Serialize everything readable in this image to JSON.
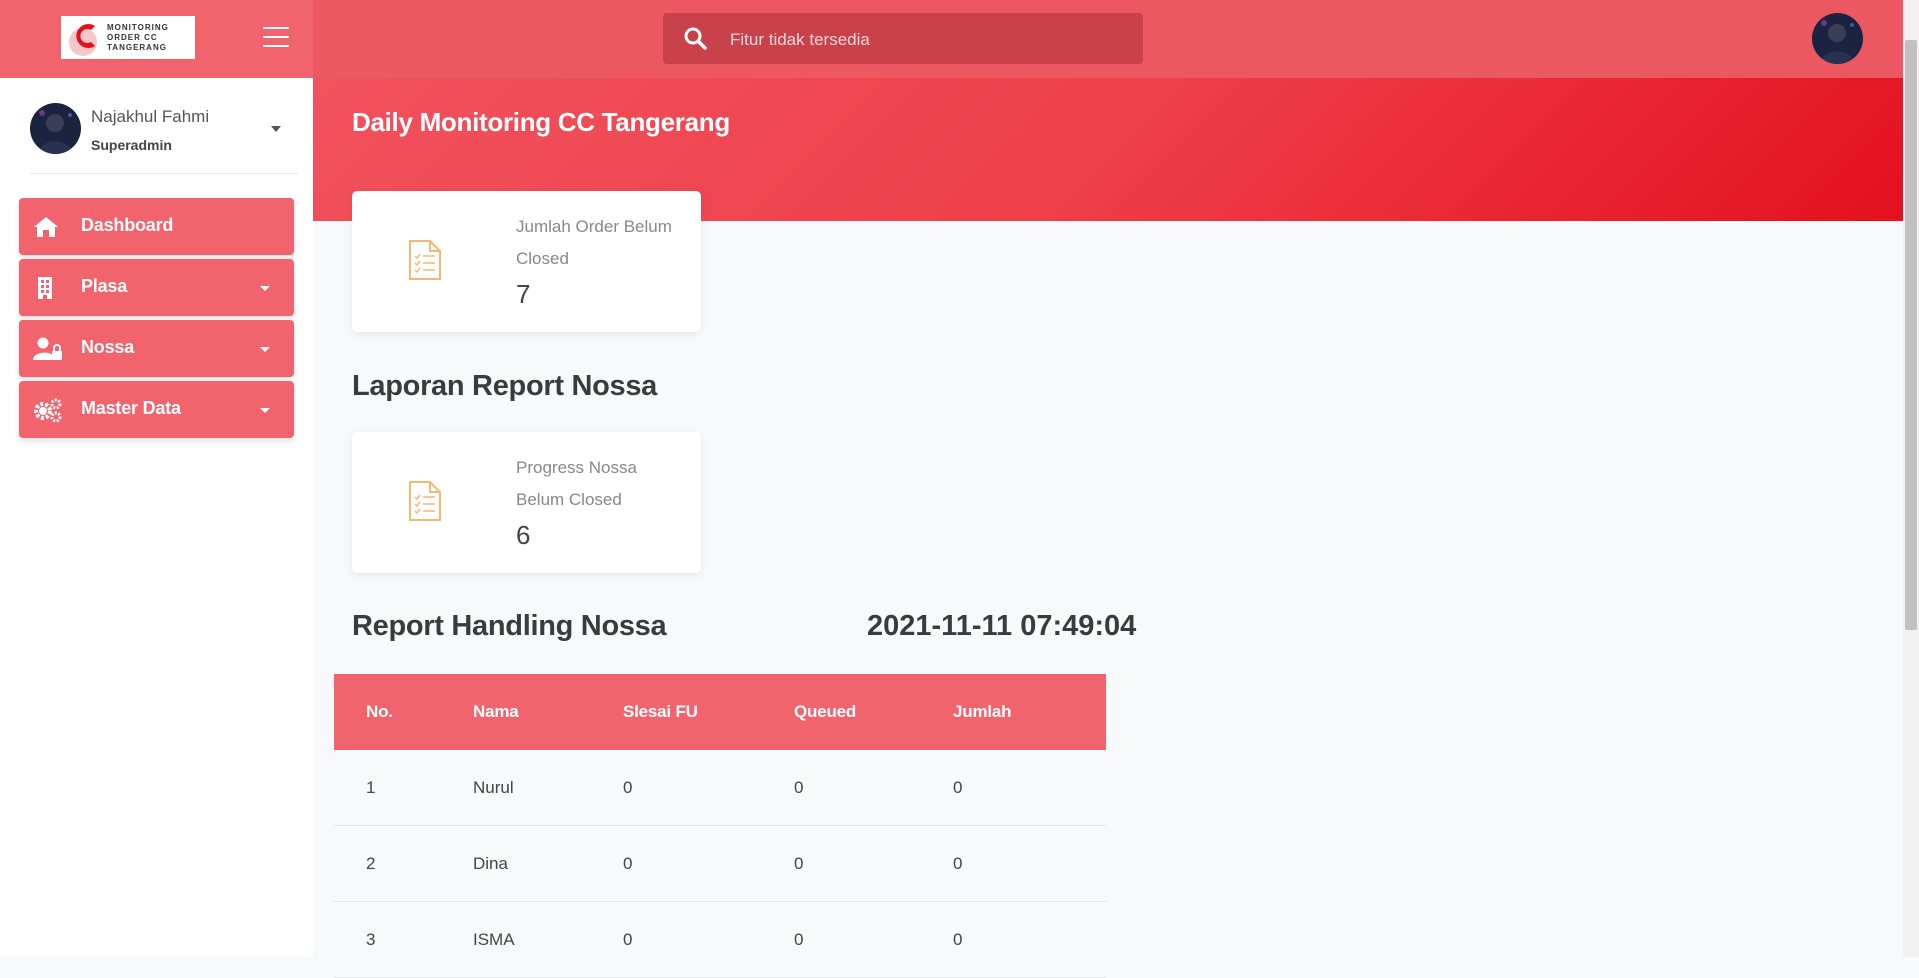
{
  "brand": {
    "logo_text": [
      "MONITORING",
      "ORDER CC",
      "TANGERANG"
    ],
    "primary_color": "#f1646e",
    "hero_color": "#e4101d"
  },
  "search": {
    "placeholder": "Fitur tidak tersedia"
  },
  "user": {
    "name": "Najakhul Fahmi",
    "role": "Superadmin"
  },
  "sidebar": {
    "items": [
      {
        "label": "Dashboard",
        "icon": "home-icon",
        "has_caret": false
      },
      {
        "label": "Plasa",
        "icon": "building-icon",
        "has_caret": true
      },
      {
        "label": "Nossa",
        "icon": "user-lock-icon",
        "has_caret": true
      },
      {
        "label": "Master Data",
        "icon": "gears-icon",
        "has_caret": true
      }
    ]
  },
  "main": {
    "title": "Daily Monitoring CC Tangerang",
    "card_order": {
      "label": "Jumlah Order Belum Closed",
      "value": "7"
    },
    "section_nossa": "Laporan Report Nossa",
    "card_nossa": {
      "label": "Progress Nossa Belum Closed",
      "value": "6"
    },
    "section_handling": "Report Handling Nossa",
    "timestamp": "2021-11-11 07:49:04"
  },
  "table": {
    "headers": [
      "No.",
      "Nama",
      "Slesai FU",
      "Queued",
      "Jumlah"
    ],
    "rows": [
      [
        "1",
        "Nurul",
        "0",
        "0",
        "0"
      ],
      [
        "2",
        "Dina",
        "0",
        "0",
        "0"
      ],
      [
        "3",
        "ISMA",
        "0",
        "0",
        "0"
      ]
    ]
  }
}
